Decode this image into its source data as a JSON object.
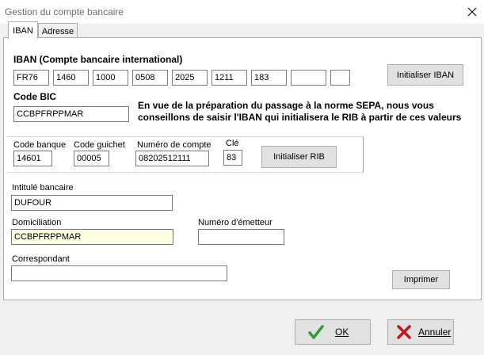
{
  "window": {
    "title": "Gestion du compte bancaire"
  },
  "tabs": [
    {
      "label": "IBAN"
    },
    {
      "label": "Adresse"
    }
  ],
  "iban": {
    "heading": "IBAN (Compte bancaire international)",
    "fields": [
      "FR76",
      "1460",
      "1000",
      "0508",
      "2025",
      "1211",
      "183",
      "",
      ""
    ],
    "init_button": "Initialiser IBAN"
  },
  "bic": {
    "heading": "Code BIC",
    "value": "CCBPFRPPMAR",
    "note": "En vue de la préparation du passage à la norme SEPA, nous vous conseillons de saisir l'IBAN qui initialisera le RIB à partir de ces valeurs"
  },
  "rib": {
    "bank_code_label": "Code banque",
    "bank_code": "14601",
    "branch_code_label": "Code guichet",
    "branch_code": "00005",
    "account_label": "Numéro de compte",
    "account": "08202512111",
    "key_label": "Clé",
    "key": "83",
    "init_button": "Initialiser RIB"
  },
  "bank_title": {
    "label": "Intitulé bancaire",
    "value": "DUFOUR"
  },
  "domiciliation": {
    "label": "Domiciliation",
    "value": "CCBPFRPPMAR"
  },
  "issuer_number": {
    "label": "Numéro d'émetteur",
    "value": ""
  },
  "correspondent": {
    "label": "Correspondant",
    "value": ""
  },
  "print_button": "Imprimer",
  "ok_button": "OK",
  "cancel_button": "Annuler",
  "colors": {
    "ok_check": "#2e9e2e",
    "cancel_x": "#c01818",
    "field_highlight": "#ffffe1"
  }
}
